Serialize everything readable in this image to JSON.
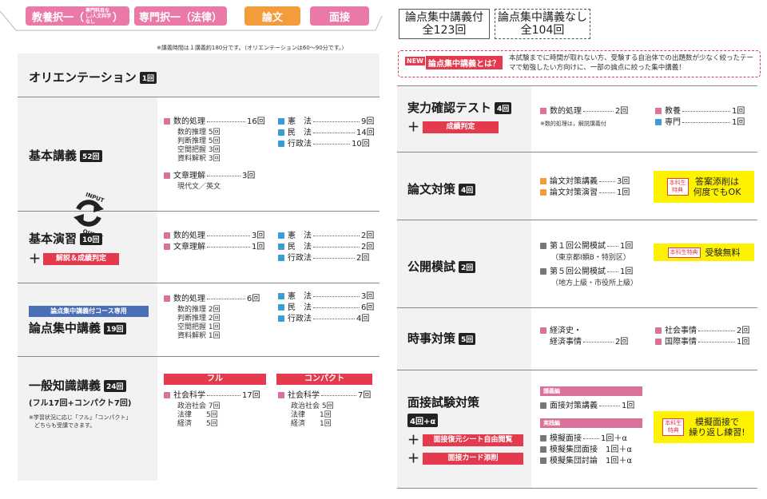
{
  "tabs": [
    {
      "label": "教養択一（",
      "small": "専門科目なし/人文科学なし",
      "tail": "）",
      "color": "#ea79a8"
    },
    {
      "label": "専門択一（法律）",
      "color": "#ea79a8"
    },
    {
      "label": "論文",
      "color": "#f39c3c"
    },
    {
      "label": "面接",
      "color": "#ea79a8"
    }
  ],
  "course_boxes": [
    {
      "line1": "論点集中講義付",
      "line2": "全123回"
    },
    {
      "line1": "論点集中講義なし",
      "line2": "全104回"
    }
  ],
  "time_note": "※講義時間は１講義約180分です。（オリエンテーションは60～90分です。）",
  "new_banner": {
    "tag": "NEW",
    "question": "論点集中講義とは？",
    "text": "本試験までに時間が取れない方、受験する自治体での出題数が少なく絞ったテーマで勉強したい方向けに、一部の論点に絞った集中講義！"
  },
  "left": {
    "orientation": {
      "title": "オリエンテーション",
      "badge": "1回"
    },
    "kihon_kougi": {
      "title": "基本講義",
      "badge": "52回",
      "items": [
        {
          "name": "数的処理",
          "count": "16回"
        },
        {
          "name": "文章理解",
          "count": "3回"
        },
        {
          "name": "憲　法",
          "count": "9回"
        },
        {
          "name": "民　法",
          "count": "14回"
        },
        {
          "name": "行政法",
          "count": "10回"
        }
      ],
      "sub1": [
        "数的推理 5回",
        "判断推理 5回",
        "空間把握 3回",
        "資料解釈 3回"
      ],
      "sub2": "現代文／英文"
    },
    "cycle": {
      "top": "INPUT",
      "bottom": "OUTPUT"
    },
    "kihon_ensyu": {
      "title": "基本演習",
      "badge": "10回",
      "plus": "＋",
      "label": "解説＆成績判定",
      "items": [
        {
          "name": "数的処理",
          "count": "3回"
        },
        {
          "name": "文章理解",
          "count": "1回"
        },
        {
          "name": "憲　法",
          "count": "2回"
        },
        {
          "name": "民　法",
          "count": "2回"
        },
        {
          "name": "行政法",
          "count": "2回"
        }
      ]
    },
    "ronten": {
      "tag": "論点集中講義付コース専用",
      "title": "論点集中講義",
      "badge": "19回",
      "items": [
        {
          "name": "数的処理",
          "count": "6回"
        },
        {
          "name": "憲　法",
          "count": "3回"
        },
        {
          "name": "民　法",
          "count": "6回"
        },
        {
          "name": "行政法",
          "count": "4回"
        }
      ],
      "sub": [
        "数的推理 2回",
        "判断推理 2回",
        "空間把握 1回",
        "資料解釈 1回"
      ]
    },
    "ippan": {
      "title": "一般知識講義",
      "badge": "24回",
      "subtitle": "(フル17回+コンパクト7回)",
      "note": [
        "※学習状況に応じ「フル」「コンパクト」",
        "　どちらも受講できます。"
      ],
      "full": {
        "header": "フル",
        "item": "社会科学",
        "count": "17回",
        "sub": [
          "政治社会 7回",
          "法律　　5回",
          "経済　　5回"
        ]
      },
      "compact": {
        "header": "コンパクト",
        "item": "社会科学",
        "count": "7回",
        "sub": [
          "政治社会 5回",
          "法律　　1回",
          "経済　　1回"
        ]
      }
    }
  },
  "right": {
    "jitsuryoku": {
      "title": "実力確認テスト",
      "badge": "4回",
      "plus": "＋",
      "label": "成績判定",
      "items": [
        {
          "name": "数的処理",
          "count": "2回"
        },
        {
          "name": "教養",
          "count": "1回"
        },
        {
          "name": "専門",
          "count": "1回"
        }
      ],
      "note": "※数的処理は，解説講義付"
    },
    "ronbun": {
      "title": "論文対策",
      "badge": "4回",
      "items": [
        {
          "name": "論文対策講義",
          "count": "3回"
        },
        {
          "name": "論文対策演習",
          "count": "1回"
        }
      ],
      "perk": {
        "tok": [
          "本科生",
          "特典"
        ],
        "text": [
          "答案添削は",
          "何度でもOK"
        ]
      }
    },
    "koukai": {
      "title": "公開模試",
      "badge": "2回",
      "items": [
        {
          "name": "第１回公開模試",
          "count": "1回",
          "sub": "（東京都Ⅰ類B・特別区）"
        },
        {
          "name": "第５回公開模試",
          "count": "1回",
          "sub": "（地方上級・市役所上級）"
        }
      ],
      "perk": {
        "tok": "本科生特典",
        "text": "受験無料"
      }
    },
    "jiji": {
      "title": "時事対策",
      "badge": "5回",
      "items": [
        {
          "name1": "経済史・",
          "name2": "経済事情",
          "count": "2回"
        },
        {
          "name": "社会事情",
          "count": "2回"
        },
        {
          "name": "国際事情",
          "count": "1回"
        }
      ]
    },
    "mensetsu": {
      "title": "面接試験対策",
      "badge": "4回+α",
      "extras": [
        {
          "plus": "＋",
          "label": "面接復元シート自由閲覧"
        },
        {
          "plus": "＋",
          "label": "面接カード添削"
        }
      ],
      "sec1": "講義編",
      "sec2": "実践編",
      "items": [
        {
          "name": "面接対策講義",
          "count": "1回"
        },
        {
          "name": "模擬面接",
          "count": "1回＋α"
        },
        {
          "name": "模擬集団面接",
          "count": "1回＋α"
        },
        {
          "name": "模擬集団討論",
          "count": "1回＋α"
        }
      ],
      "perk": {
        "tok": [
          "本科生",
          "特典"
        ],
        "text": [
          "模擬面接で",
          "繰り返し練習!"
        ]
      }
    }
  }
}
